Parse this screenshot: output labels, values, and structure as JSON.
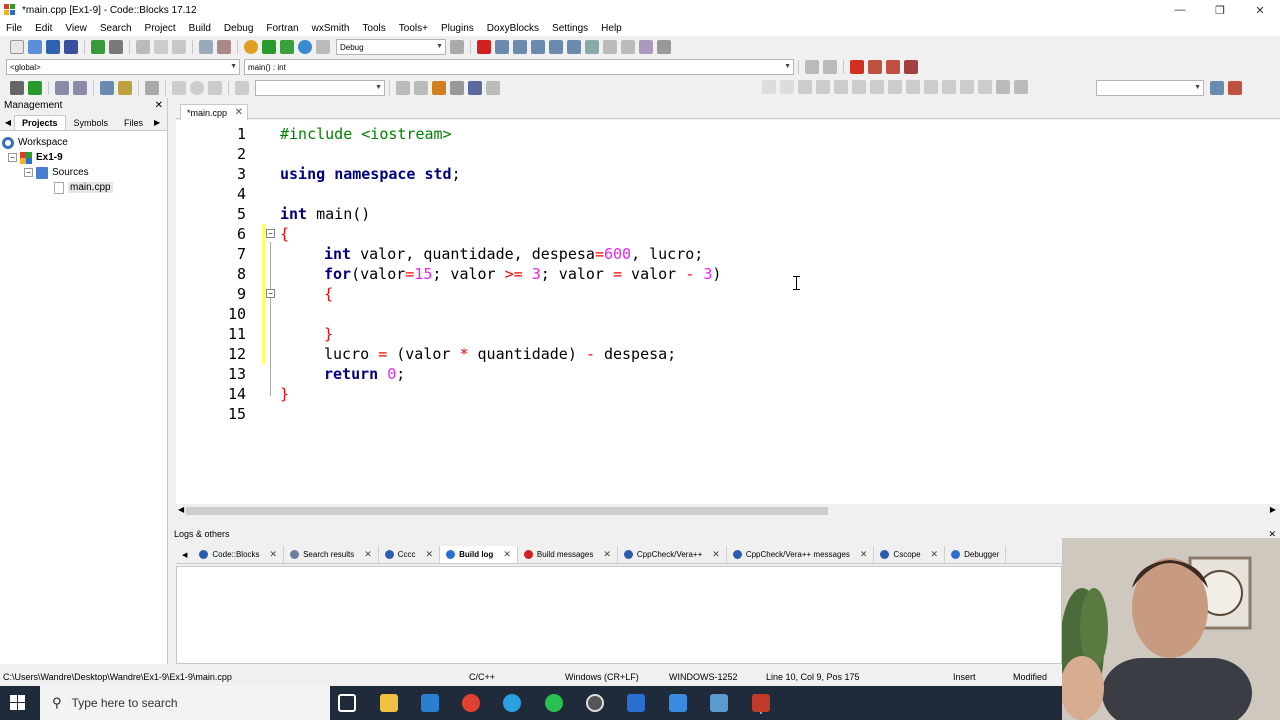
{
  "window": {
    "title": "*main.cpp [Ex1-9] - Code::Blocks 17.12"
  },
  "menu": [
    "File",
    "Edit",
    "View",
    "Search",
    "Project",
    "Build",
    "Debug",
    "Fortran",
    "wxSmith",
    "Tools",
    "Tools+",
    "Plugins",
    "DoxyBlocks",
    "Settings",
    "Help"
  ],
  "toolbar": {
    "build_target": "Debug",
    "scope_combo": "<global>",
    "function_combo": "main() : int"
  },
  "management": {
    "title": "Management",
    "tabs": [
      "Projects",
      "Symbols",
      "Files"
    ],
    "active_tab": "Projects",
    "tree": {
      "workspace": "Workspace",
      "project": "Ex1-9",
      "folder": "Sources",
      "file": "main.cpp"
    }
  },
  "editor": {
    "tab_label": "*main.cpp",
    "lines": [
      {
        "n": "1"
      },
      {
        "n": "2"
      },
      {
        "n": "3"
      },
      {
        "n": "4"
      },
      {
        "n": "5"
      },
      {
        "n": "6"
      },
      {
        "n": "7"
      },
      {
        "n": "8"
      },
      {
        "n": "9"
      },
      {
        "n": "10"
      },
      {
        "n": "11"
      },
      {
        "n": "12"
      },
      {
        "n": "13"
      },
      {
        "n": "14"
      },
      {
        "n": "15"
      }
    ],
    "code": {
      "l1": "#include <iostream>",
      "l3_kw1": "using",
      "l3_kw2": "namespace",
      "l3_kw3": "std",
      "l3_end": ";",
      "l5_kw": "int",
      "l5_rest": " main()",
      "l6": "{",
      "l7_kw": "int",
      "l7_a": " valor, quantidade, despesa",
      "l7_eq": "=",
      "l7_num": "600",
      "l7_b": ", lucro;",
      "l8_kw": "for",
      "l8_a": "(valor",
      "l8_eq": "=",
      "l8_n1": "15",
      "l8_b": "; valor ",
      "l8_ge": ">=",
      "l8_c": " ",
      "l8_n2": "3",
      "l8_d": "; valor ",
      "l8_eq2": "=",
      "l8_e": " valor ",
      "l8_minus": "-",
      "l8_f": " ",
      "l8_n3": "3",
      "l8_g": ")",
      "l9": "{",
      "l11": "}",
      "l12_a": "lucro ",
      "l12_eq": "=",
      "l12_b": " (valor ",
      "l12_mul": "*",
      "l12_c": " quantidade) ",
      "l12_minus": "-",
      "l12_d": " despesa;",
      "l13_kw": "return",
      "l13_sp": " ",
      "l13_num": "0",
      "l13_end": ";",
      "l14": "}"
    }
  },
  "logs": {
    "title": "Logs & others",
    "tabs": [
      {
        "label": "Code::Blocks",
        "color": "#2a5db0"
      },
      {
        "label": "Search results",
        "color": "#6a7fa0"
      },
      {
        "label": "Cccc",
        "color": "#2a5db0"
      },
      {
        "label": "Build log",
        "color": "#2a6fd0"
      },
      {
        "label": "Build messages",
        "color": "#d02020"
      },
      {
        "label": "CppCheck/Vera++",
        "color": "#2a5db0"
      },
      {
        "label": "CppCheck/Vera++ messages",
        "color": "#2a5db0"
      },
      {
        "label": "Cscope",
        "color": "#2a5db0"
      },
      {
        "label": "Debugger",
        "color": "#2a6fd0"
      }
    ],
    "active_tab": "Build log"
  },
  "statusbar": {
    "path": "C:\\Users\\Wandre\\Desktop\\Wandre\\Ex1-9\\Ex1-9\\main.cpp",
    "language": "C/C++",
    "eol": "Windows (CR+LF)",
    "encoding": "WINDOWS-1252",
    "position": "Line 10, Col 9, Pos 175",
    "mode": "Insert",
    "state": "Modified"
  },
  "taskbar": {
    "search_placeholder": "Type here to search"
  }
}
